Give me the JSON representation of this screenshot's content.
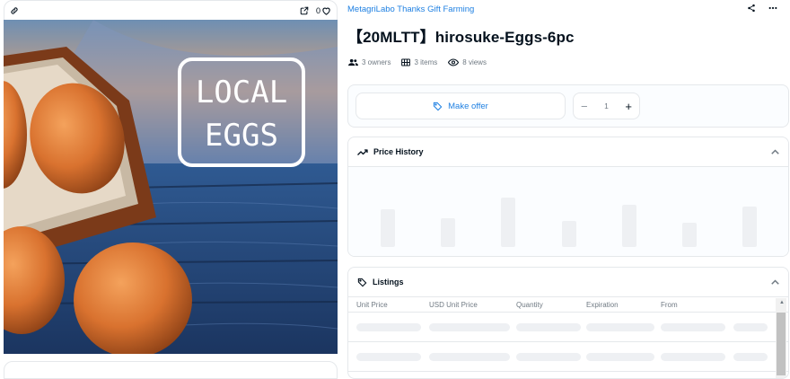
{
  "left": {
    "favorites_count": "0",
    "image_text_line1": "LOCAL",
    "image_text_line2": "EGGS"
  },
  "item": {
    "collection": "MetagriLabo Thanks Gift Farming",
    "title": "【20MLTT】hirosuke-Eggs-6pc"
  },
  "stats": {
    "owners": "3 owners",
    "items": "3 items",
    "views": "8 views"
  },
  "offer": {
    "make_offer_label": "Make offer",
    "quantity": "1",
    "minus": "−",
    "plus": "+"
  },
  "price_history": {
    "title": "Price History"
  },
  "listings": {
    "title": "Listings",
    "columns": [
      "Unit Price",
      "USD Unit Price",
      "Quantity",
      "Expiration",
      "From"
    ]
  },
  "colors": {
    "accent": "#2081e2",
    "text": "#04111d",
    "muted": "#707a83",
    "border": "#e5e8eb",
    "skeleton": "#eef0f3"
  },
  "icons": [
    "link-icon",
    "external-link-icon",
    "heart-icon",
    "share-icon",
    "more-icon",
    "owners-icon",
    "items-icon",
    "eye-icon",
    "tag-icon",
    "trend-icon",
    "chevron-up-icon"
  ]
}
